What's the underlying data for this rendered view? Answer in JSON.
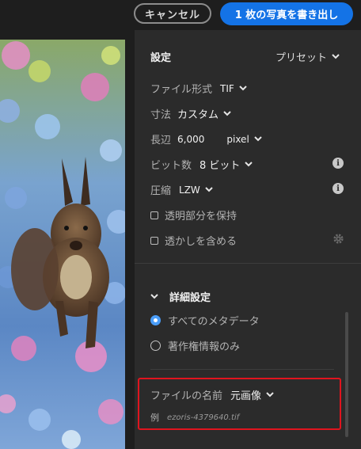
{
  "toolbar": {
    "cancel_label": "キャンセル",
    "export_label": "1 枚の写真を書き出し"
  },
  "settings": {
    "title": "設定",
    "preset_label": "プリセット",
    "file_type_label": "ファイル形式",
    "file_type_value": "TIF",
    "dimensions_label": "寸法",
    "dimensions_value": "カスタム",
    "long_edge_label": "長辺",
    "long_edge_value": "6,000",
    "unit_value": "pixel",
    "bit_depth_label": "ビット数",
    "bit_depth_value": "8 ビット",
    "compression_label": "圧縮",
    "compression_value": "LZW",
    "keep_transparency_label": "透明部分を保持",
    "include_watermark_label": "透かしを含める"
  },
  "advanced": {
    "title": "詳細設定",
    "metadata_all_label": "すべてのメタデータ",
    "metadata_copyright_label": "著作権情報のみ",
    "selected_metadata": "すべてのメタデータ"
  },
  "filename": {
    "label": "ファイルの名前",
    "value": "元画像",
    "example_prefix": "例",
    "example_value": "ezoris-4379640.tif"
  },
  "colors": {
    "accent": "#1473e6",
    "highlight_box": "#e0141e"
  }
}
